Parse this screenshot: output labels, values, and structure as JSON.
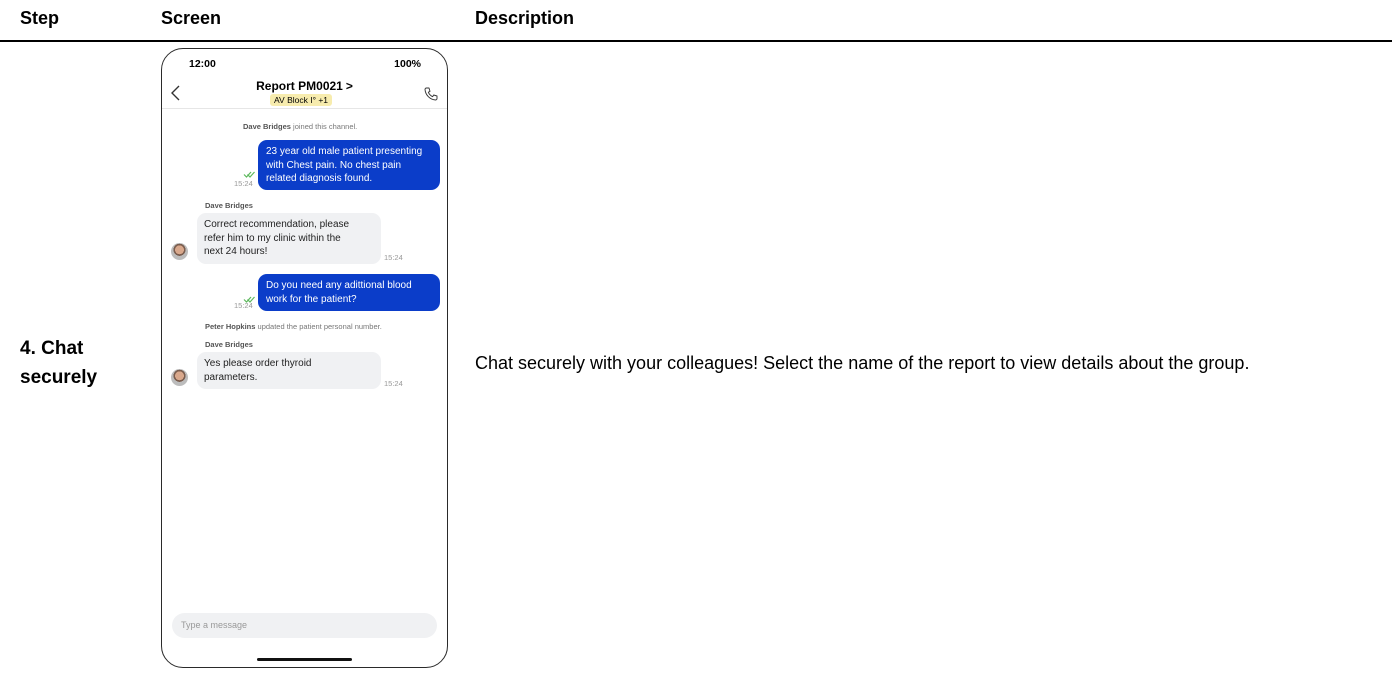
{
  "table": {
    "headers": {
      "step": "Step",
      "screen": "Screen",
      "description": "Description"
    },
    "row": {
      "step_label": "4. Chat securely",
      "description": "Chat securely with your colleagues! Select the name of the report to view details about the group."
    }
  },
  "phone": {
    "status": {
      "time": "12:00",
      "battery": "100%"
    },
    "nav": {
      "title": "Report PM0021",
      "title_chevron": ">",
      "tag": "AV Block I° +1",
      "back_icon": "chevron-left-icon",
      "call_icon": "phone-icon"
    },
    "messages": [
      {
        "type": "system",
        "name": "Dave Bridges",
        "text": "joined this channel."
      },
      {
        "type": "outgoing",
        "lines": [
          "23 year old male patient presenting",
          "with Chest pain. No chest pain",
          "related diagnosis found."
        ],
        "time": "15:24"
      },
      {
        "type": "incoming",
        "sender": "Dave Bridges",
        "lines": [
          "Correct recommendation, please",
          "refer him to my clinic within the",
          "next 24 hours!"
        ],
        "time": "15:24"
      },
      {
        "type": "outgoing",
        "lines": [
          "Do you need any adittional blood",
          "work for the patient?"
        ],
        "time": "15:24"
      },
      {
        "type": "system",
        "name": "Peter Hopkins",
        "text": "updated the patient personal number."
      },
      {
        "type": "incoming",
        "sender": "Dave Bridges",
        "lines": [
          "Yes please order thyroid",
          "parameters."
        ],
        "time": "15:24"
      }
    ],
    "input": {
      "placeholder": "Type a message"
    },
    "colors": {
      "outgoing_bubble": "#0b3dc9",
      "incoming_bubble": "#f0f1f3",
      "tag_bg": "#f7ecae",
      "read_check": "#5cb85c"
    }
  }
}
